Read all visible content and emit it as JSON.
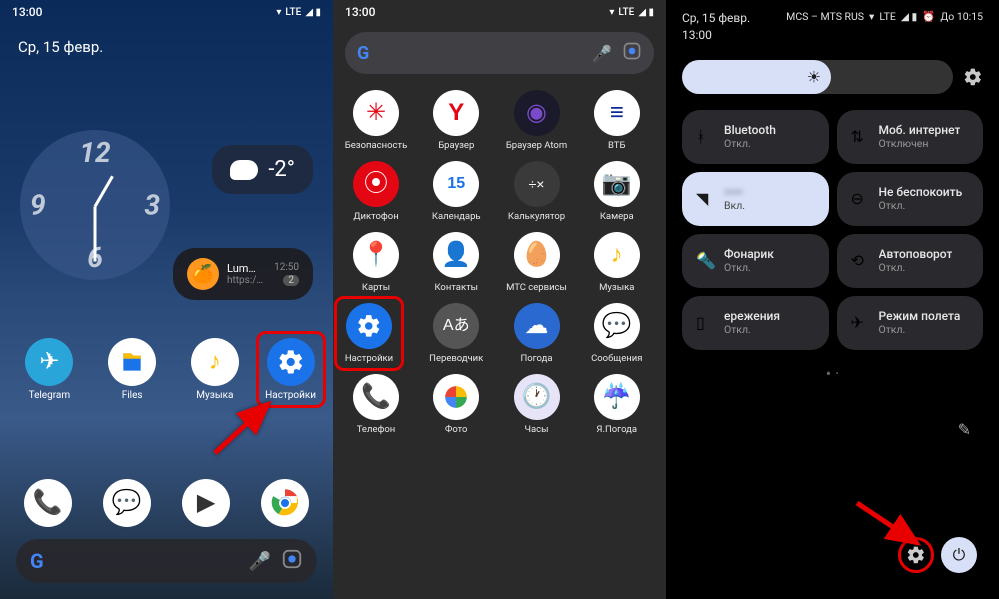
{
  "status": {
    "time": "13:00",
    "net": "LTE"
  },
  "panel1": {
    "date": "Ср, 15 февр.",
    "clock_numbers": {
      "n12": "12",
      "n3": "3",
      "n6": "6",
      "n9": "9"
    },
    "weather_temp": "-2°",
    "notif": {
      "title": "Lum…",
      "url": "https:/…",
      "time": "12:50",
      "count": "2"
    },
    "apps": [
      "Telegram",
      "Files",
      "Музыка",
      "Настройки"
    ],
    "gbar": {
      "logo": "G"
    }
  },
  "panel2": {
    "apps": [
      "Безопасность",
      "Браузер",
      "Браузер Atom",
      "ВТБ",
      "Диктофон",
      "Календарь",
      "Калькулятор",
      "Камера",
      "Карты",
      "Контакты",
      "МТС сервисы",
      "Музыка",
      "Настройки",
      "Переводчик",
      "Погода",
      "Сообщения",
      "Телефон",
      "Фото",
      "Часы",
      "Я.Погода"
    ]
  },
  "panel3": {
    "date": "Ср, 15 февр.",
    "time": "13:00",
    "carrier": "MCS – MTS RUS",
    "net": "LTE",
    "alarm": "До 10:15",
    "tiles": [
      {
        "name": "Bluetooth",
        "state": "Откл.",
        "icon": "bt",
        "active": false
      },
      {
        "name": "Моб. интернет",
        "state": "Отключен",
        "icon": "data",
        "active": false
      },
      {
        "name": "——",
        "state": "Вкл.",
        "icon": "wifi",
        "active": true,
        "blur": true
      },
      {
        "name": "Не беспокоить",
        "state": "Откл.",
        "icon": "dnd",
        "active": false
      },
      {
        "name": "Фонарик",
        "state": "Откл.",
        "icon": "flash",
        "active": false
      },
      {
        "name": "Автоповорот",
        "state": "Откл.",
        "icon": "rotate",
        "active": false
      },
      {
        "name": "ережения",
        "state": "Откл.",
        "icon": "battery",
        "active": false
      },
      {
        "name": "Режим полета",
        "state": "Откл.",
        "icon": "plane",
        "active": false
      }
    ]
  }
}
